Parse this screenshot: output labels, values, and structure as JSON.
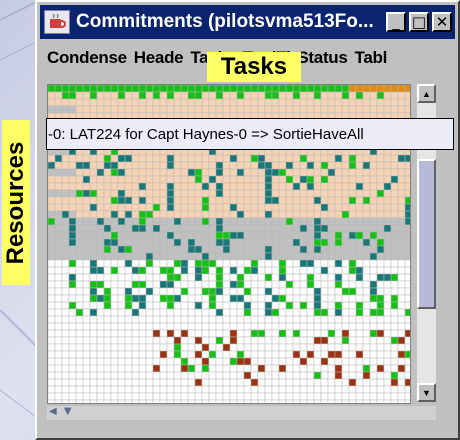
{
  "window": {
    "title": "Commitments (pilotsvma513Fo...",
    "min_glyph": "_",
    "max_glyph": "□",
    "close_glyph": "✕"
  },
  "menu": [
    "Condense",
    "Heade",
    "Tasks",
    "ToolTi",
    "Status",
    "Tabl"
  ],
  "annotations": {
    "tasks_label": "Tasks",
    "resources_label": "Resources"
  },
  "tooltip": "-0: LAT224 for Capt Haynes-0 => SortieHaveAll",
  "scroll": {
    "up_glyph": "▲",
    "down_glyph": "▼",
    "h_glyph": "◀ ▼"
  },
  "colors": {
    "empty": "#ffffff",
    "available": "#f5d3b4",
    "unavailable": "#c0c0c0",
    "green": "#17c017",
    "teal": "#1a7777",
    "brown": "#993311",
    "orange": "#e08a10",
    "gridline": "#b8b8b8",
    "highlight": "#ffff66",
    "titlebar": "#0a2470"
  }
}
